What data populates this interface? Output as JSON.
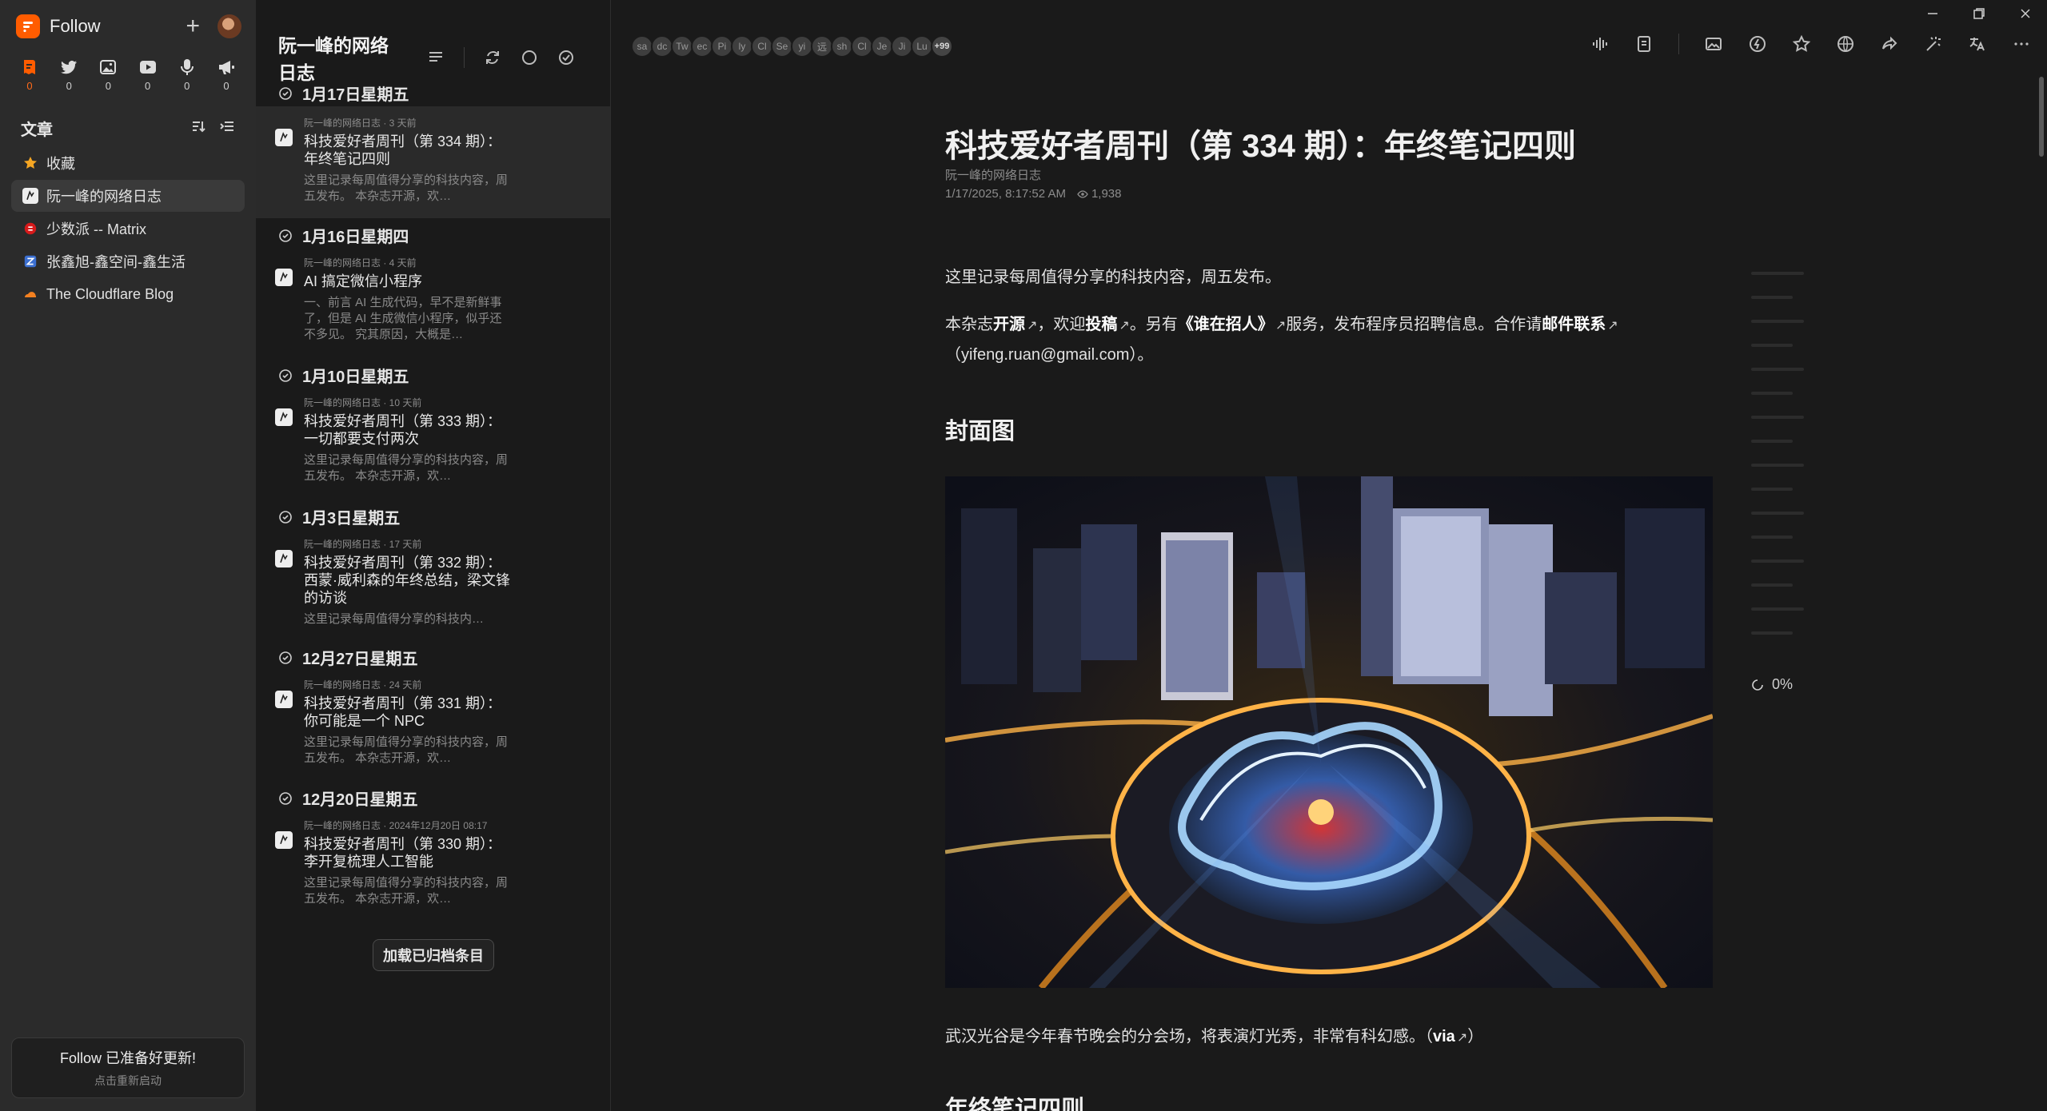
{
  "app": {
    "name": "Follow"
  },
  "views": [
    {
      "icon": "article-icon",
      "count": "0",
      "active": true
    },
    {
      "icon": "twitter-icon",
      "count": "0"
    },
    {
      "icon": "picture-icon",
      "count": "0"
    },
    {
      "icon": "video-icon",
      "count": "0"
    },
    {
      "icon": "microphone-icon",
      "count": "0"
    },
    {
      "icon": "megaphone-icon",
      "count": "0"
    }
  ],
  "sidebar": {
    "section_title": "文章",
    "feeds": [
      {
        "label": "收藏",
        "icon": "star-icon",
        "color": "#f5a623"
      },
      {
        "label": "阮一峰的网络日志",
        "icon": "feed-icon",
        "active": true
      },
      {
        "label": "少数派 -- Matrix",
        "icon": "sspai-icon",
        "color": "#d71a1b"
      },
      {
        "label": "张鑫旭-鑫空间-鑫生活",
        "icon": "zxx-icon",
        "color": "#3b6fd1"
      },
      {
        "label": "The Cloudflare Blog",
        "icon": "cloudflare-icon",
        "color": "#f38020"
      }
    ],
    "update": {
      "title": "Follow 已准备好更新!",
      "subtitle": "点击重新启动"
    }
  },
  "entries": {
    "title": "阮一峰的网络日志",
    "days": [
      {
        "label": "1月17日星期五"
      },
      {
        "label": "1月16日星期四"
      },
      {
        "label": "1月10日星期五"
      },
      {
        "label": "1月3日星期五"
      },
      {
        "label": "12月27日星期五"
      },
      {
        "label": "12月20日星期五"
      }
    ],
    "items": [
      {
        "meta": "阮一峰的网络日志 · 3 天前",
        "title": "科技爱好者周刊（第 334 期）：年终笔记四则",
        "snippet": "这里记录每周值得分享的科技内容，周五发布。 本杂志开源，欢…"
      },
      {
        "meta": "阮一峰的网络日志 · 4 天前",
        "title": "AI 搞定微信小程序",
        "snippet": "一、前言 AI 生成代码，早不是新鲜事了，但是 AI 生成微信小程序，似乎还不多见。 究其原因，大概是…"
      },
      {
        "meta": "阮一峰的网络日志 · 10 天前",
        "title": "科技爱好者周刊（第 333 期）：一切都要支付两次",
        "snippet": "这里记录每周值得分享的科技内容，周五发布。 本杂志开源，欢…"
      },
      {
        "meta": "阮一峰的网络日志 · 17 天前",
        "title": "科技爱好者周刊（第 332 期）：西蒙·威利森的年终总结，梁文锋的访谈",
        "snippet": "这里记录每周值得分享的科技内…"
      },
      {
        "meta": "阮一峰的网络日志 · 24 天前",
        "title": "科技爱好者周刊（第 331 期）：你可能是一个 NPC",
        "snippet": "这里记录每周值得分享的科技内容，周五发布。 本杂志开源，欢…"
      },
      {
        "meta": "阮一峰的网络日志 · 2024年12月20日 08:17",
        "title": "科技爱好者周刊（第 330 期）：李开复梳理人工智能",
        "snippet": "这里记录每周值得分享的科技内容，周五发布。 本杂志开源，欢…"
      }
    ],
    "load_more": "加载已归档条目"
  },
  "reader": {
    "avatars": [
      "sa",
      "dc",
      "Tw",
      "ec",
      "Pi",
      "ly",
      "Cl",
      "Se",
      "yi",
      "远",
      "sh",
      "Cl",
      "Je",
      "Ji",
      "Lu"
    ],
    "avatars_more": "+99",
    "article": {
      "title": "科技爱好者周刊（第 334 期）：年终笔记四则",
      "source": "阮一峰的网络日志",
      "date": "1/17/2025, 8:17:52 AM",
      "views": "1,938",
      "intro": "这里记录每周值得分享的科技内容，周五发布。",
      "p2": {
        "t1": "本杂志",
        "l1": "开源",
        "t2": "，欢迎",
        "l2": "投稿",
        "t3": "。另有",
        "l3": "《谁在招人》",
        "t4": "服务，发布程序员招聘信息。合作请",
        "l4": "邮件联系",
        "t5": "（yifeng.ruan@gmail.com）。"
      },
      "h_cover": "封面图",
      "caption_text": "武汉光谷是今年春节晚会的分会场，将表演灯光秀，非常有科幻感。（",
      "caption_link": "via",
      "caption_end": "）",
      "h_next": "年终笔记四则"
    },
    "progress": "0%"
  },
  "colors": {
    "accent": "#ff5c00",
    "bg": "#1a1a1a",
    "sidebar": "#2b2b2b"
  }
}
